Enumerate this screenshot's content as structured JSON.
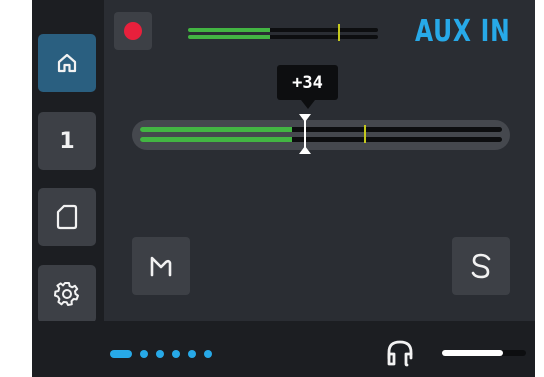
{
  "colors": {
    "accent": "#27a9e8",
    "record": "#e8203c",
    "meter_green": "#43b543",
    "peak_marker": "#c4c81e",
    "panel": "#2a2d33",
    "sidebar": "#1c1e22",
    "button": "#3d4046",
    "active_button": "#2a5f80"
  },
  "sidebar": {
    "items": [
      {
        "name": "home",
        "icon": "home-icon",
        "active": true
      },
      {
        "name": "channel",
        "label": "1"
      },
      {
        "name": "sd-card",
        "icon": "sd-card-icon"
      },
      {
        "name": "settings",
        "icon": "gear-icon"
      }
    ]
  },
  "header": {
    "record_icon": "record-dot-icon",
    "source_label": "AUX IN"
  },
  "gain": {
    "tooltip": "+34",
    "level_fraction": 0.42,
    "peak_fraction": 0.62
  },
  "mini_meter": {
    "level_fraction": 0.43,
    "peak_fraction": 0.79
  },
  "buttons": {
    "mute_icon": "mute-m-icon",
    "solo_icon": "solo-s-icon"
  },
  "footer": {
    "page_count": 6,
    "active_page": 0,
    "headphone_icon": "headphones-icon",
    "headphone_level": 0.73
  }
}
